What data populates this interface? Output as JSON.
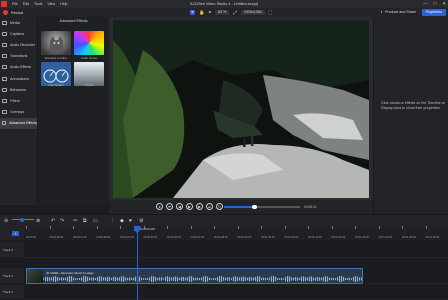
{
  "window": {
    "title": "ACDSee Video Studio 4 - Untitled.avsprj",
    "menu": [
      "File",
      "Edit",
      "Tools",
      "View",
      "Help"
    ],
    "controls": [
      "—",
      "□",
      "✕"
    ]
  },
  "toolbar": {
    "record_label": "Record",
    "zoom_value": "83 %",
    "resolution": "1920x1080",
    "produce_label": "Produce and Share",
    "properties_label": "Properties"
  },
  "sidebar": {
    "items": [
      {
        "label": "Media",
        "icon": "media-icon"
      },
      {
        "label": "Captions",
        "icon": "captions-icon"
      },
      {
        "label": "Audio Recorder",
        "icon": "mic-icon"
      },
      {
        "label": "Transitions",
        "icon": "transitions-icon"
      },
      {
        "label": "Audio Effects",
        "icon": "audio-effects-icon"
      },
      {
        "label": "Annotations",
        "icon": "annotations-icon"
      },
      {
        "label": "Behaviors",
        "icon": "behaviors-icon"
      },
      {
        "label": "Filters",
        "icon": "filters-icon"
      },
      {
        "label": "Overlays",
        "icon": "overlays-icon"
      },
      {
        "label": "Advanced Effects",
        "icon": "advanced-effects-icon"
      }
    ],
    "active_index": 9
  },
  "panel": {
    "title": "Advanced Effects",
    "effects": [
      {
        "label": "Remove a Color"
      },
      {
        "label": "Color Curve"
      },
      {
        "label": "City Splash"
      },
      {
        "label": "Tinted"
      }
    ]
  },
  "preview": {
    "time_readout": "00:00:31"
  },
  "properties": {
    "hint": "Click media or effects on the Timeline or Display Area to show their properties."
  },
  "timeline": {
    "playhead_time": "00:00:04:05",
    "ticks": [
      "00:00:00",
      "00:00:06:00",
      "00:00:12:00",
      "00:00:18:00",
      "00:00:24:00",
      "00:00:30:00",
      "00:00:36:00",
      "00:00:42:00",
      "00:00:48:00",
      "00:00:54:00",
      "00:01:00:00",
      "00:01:06:00",
      "00:01:12:00",
      "00:01:18:00",
      "00:01:24:00",
      "00:01:30:00",
      "00:01:36:00",
      "00:01:42:00"
    ],
    "tracks": [
      "Track 3",
      "Track 2",
      "Track 1"
    ],
    "clip_label": "4K FREE - Mountain Stock Footage"
  },
  "colors": {
    "accent": "#2c62d6",
    "record": "#e53935"
  }
}
